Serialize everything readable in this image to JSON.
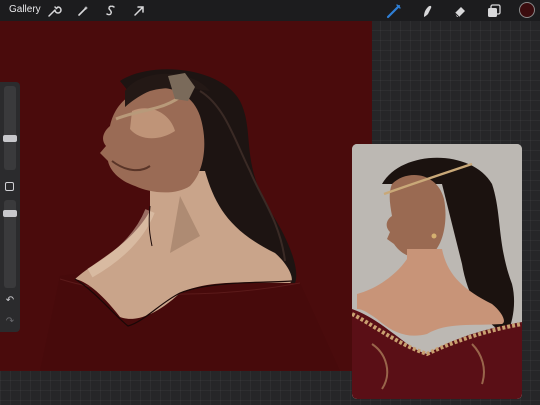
{
  "toolbar": {
    "gallery_label": "Gallery",
    "left_tools": [
      "wrench-icon",
      "magic-wand-icon",
      "selection-s-icon",
      "transform-arrow-icon"
    ],
    "right_tools": [
      "brush-icon",
      "smudge-icon",
      "eraser-icon",
      "layers-icon"
    ],
    "active_tool": "brush-icon",
    "accent_color": "#2f7fd6",
    "current_color": "#3b0c0e"
  },
  "sidebar": {
    "brush_size": 0.7,
    "opacity": 0.8,
    "modify_button_icon": "square-icon",
    "undo_icon": "undo-icon",
    "redo_icon": "redo-icon"
  },
  "canvas": {
    "background_color": "#4a0b0c"
  },
  "reference_window": {
    "visible": true
  }
}
